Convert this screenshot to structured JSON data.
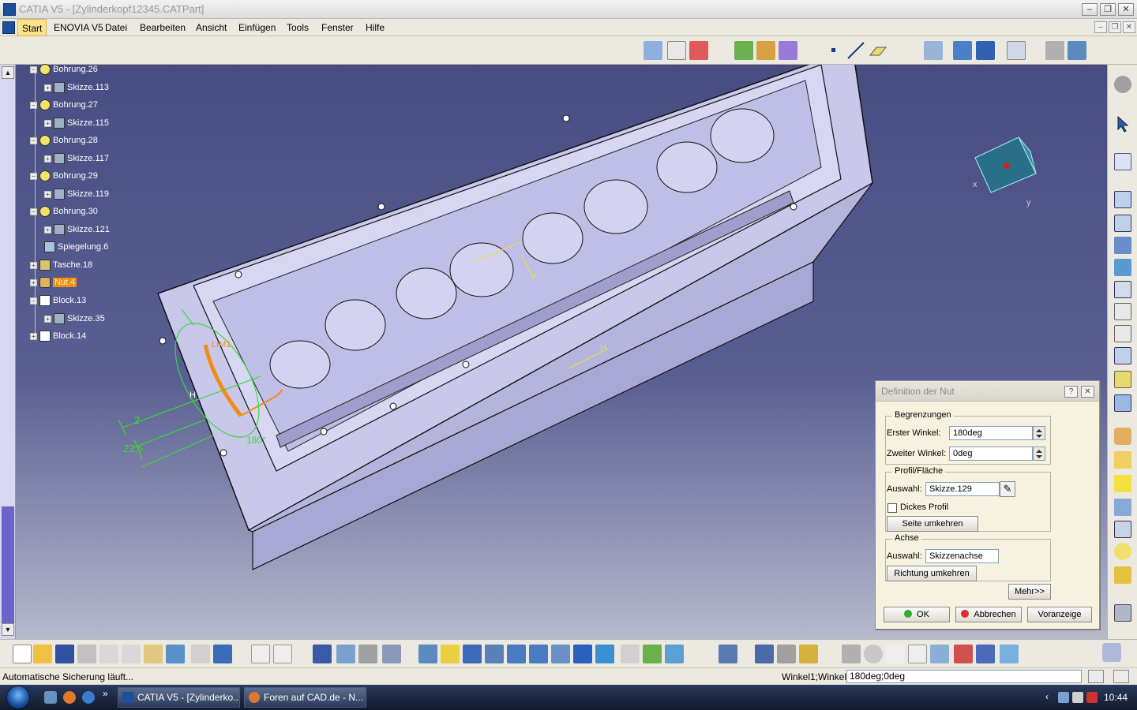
{
  "window": {
    "title": "CATIA V5 - [Zylinderkopf12345.CATPart]"
  },
  "menu": {
    "items": [
      "Start",
      "ENOVIA V5",
      "Datei",
      "Bearbeiten",
      "Ansicht",
      "Einfügen",
      "Tools",
      "Fenster",
      "Hilfe"
    ]
  },
  "tree": {
    "items": [
      {
        "label": "Bohrung.26",
        "type": "bore"
      },
      {
        "label": "Skizze.113",
        "type": "sketch"
      },
      {
        "label": "Bohrung.27",
        "type": "bore"
      },
      {
        "label": "Skizze.115",
        "type": "sketch"
      },
      {
        "label": "Bohrung.28",
        "type": "bore"
      },
      {
        "label": "Skizze.117",
        "type": "sketch"
      },
      {
        "label": "Bohrung.29",
        "type": "bore"
      },
      {
        "label": "Skizze.119",
        "type": "sketch"
      },
      {
        "label": "Bohrung.30",
        "type": "bore"
      },
      {
        "label": "Skizze.121",
        "type": "sketch"
      },
      {
        "label": "Spiegelung.6",
        "type": "mirror"
      },
      {
        "label": "Tasche.18",
        "type": "pocket"
      },
      {
        "label": "Nut.4",
        "type": "groove",
        "selected": true
      },
      {
        "label": "Block.13",
        "type": "pad"
      },
      {
        "label": "Skizze.35",
        "type": "sketch"
      },
      {
        "label": "Block.14",
        "type": "pad"
      }
    ]
  },
  "viewport": {
    "dim_2": "2",
    "dim_23_5": "23,5",
    "dim_angle": "180°",
    "lim1": "LIM1",
    "h_label": "H",
    "v_label": "V",
    "compass_x": "x",
    "compass_y": "y"
  },
  "dialog": {
    "title": "Definition der Nut",
    "group_limits": "Begrenzungen",
    "first_angle_label": "Erster Winkel:",
    "first_angle_value": "180deg",
    "second_angle_label": "Zweiter Winkel:",
    "second_angle_value": "0deg",
    "group_profile": "Profil/Fläche",
    "profile_selection_label": "Auswahl:",
    "profile_selection_value": "Skizze.129",
    "thick_profile_label": "Dickes Profil",
    "reverse_side_label": "Seite umkehren",
    "group_axis": "Achse",
    "axis_selection_label": "Auswahl:",
    "axis_selection_value": "Skizzenachse",
    "reverse_direction_label": "Richtung umkehren",
    "more_label": "Mehr>>",
    "ok_label": "OK",
    "cancel_label": "Abbrechen",
    "preview_label": "Voranzeige"
  },
  "status": {
    "message": "Automatische Sicherung läuft...",
    "param_label": "Winkel1;Winkel2",
    "param_value": "180deg;0deg"
  },
  "taskbar": {
    "chevrons": "»",
    "tasks": [
      "CATIA V5 - [Zylinderko...",
      "Foren auf CAD.de - N..."
    ],
    "clock": "10:44"
  },
  "colors": {
    "viewport_top": "#474d82",
    "part_fill": "#c9c8ea",
    "selection_orange": "#f08c1a",
    "dimension_green": "#39d93a",
    "ok_green": "#2fae2f",
    "cancel_red": "#d63030"
  }
}
